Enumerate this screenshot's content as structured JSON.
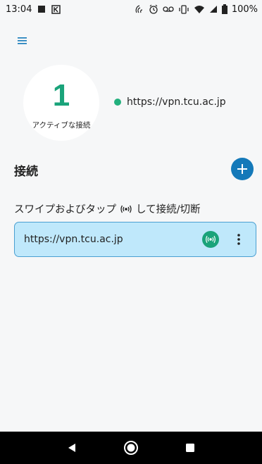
{
  "status_bar": {
    "time": "13:04",
    "battery": "100%",
    "icons": [
      "notification-square-icon",
      "k-box-icon",
      "nfc-icon",
      "alarm-icon",
      "voicemail-icon",
      "vibrate-icon",
      "wifi-icon",
      "signal-icon",
      "battery-icon"
    ]
  },
  "dashboard": {
    "active_count": "1",
    "active_label": "アクティブな接続",
    "active_url": "https://vpn.tcu.ac.jp"
  },
  "connections": {
    "title": "接続",
    "hint_prefix": "スワイプおよびタップ",
    "hint_suffix": "して接続/切断",
    "items": [
      {
        "url": "https://vpn.tcu.ac.jp",
        "status": "connected"
      }
    ]
  },
  "colors": {
    "accent_green": "#1aa37a",
    "accent_blue": "#1479b9",
    "row_bg": "#bfe8fb"
  }
}
